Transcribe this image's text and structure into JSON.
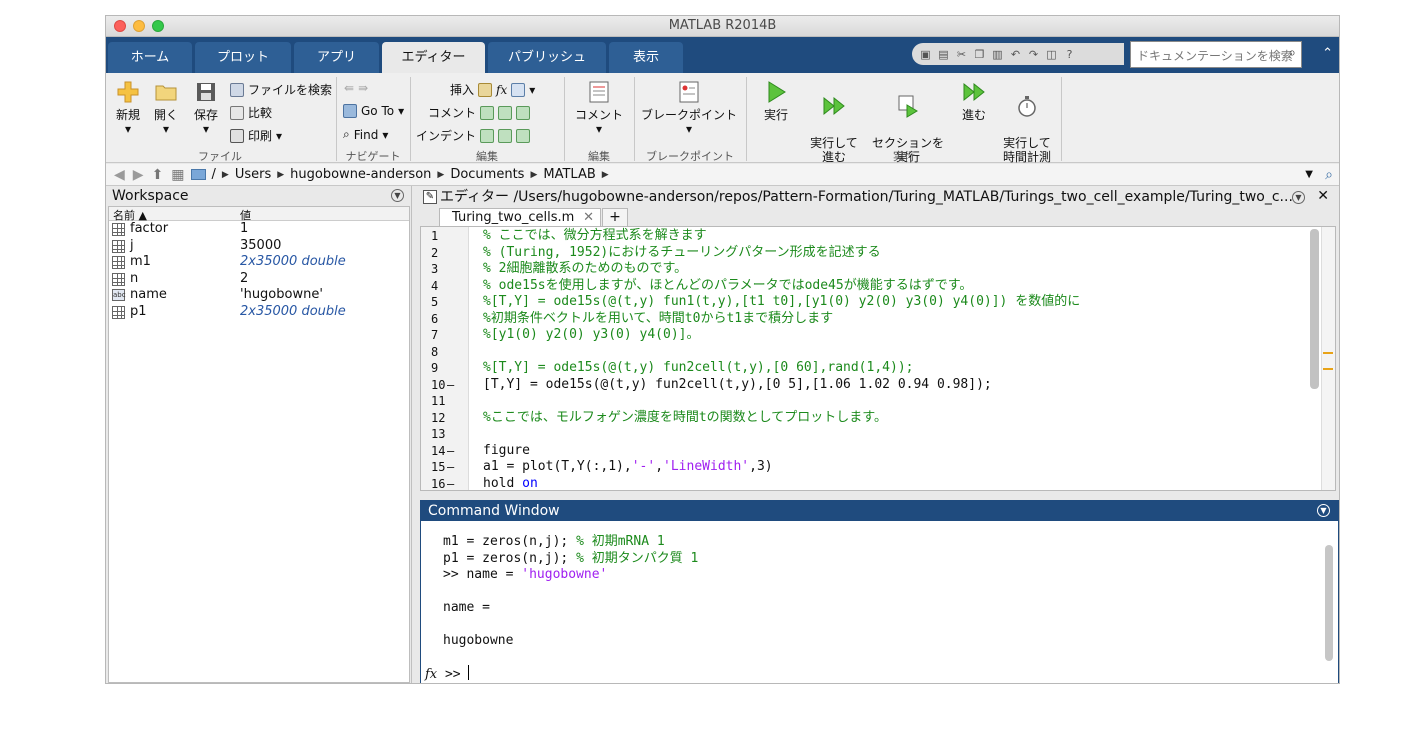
{
  "window": {
    "title": "MATLAB R2014B"
  },
  "tabs": [
    "ホーム",
    "プロット",
    "アプリ",
    "エディター",
    "パブリッシュ",
    "表示"
  ],
  "active_tab": "エディター",
  "doc_search": {
    "placeholder": "ドキュメンテーションを検索"
  },
  "toolstrip": {
    "file": {
      "label": "ファイル",
      "new": "新規",
      "open": "開く",
      "save": "保存",
      "find_files": "ファイルを検索",
      "compare": "比較",
      "print": "印刷"
    },
    "navigate": {
      "label": "ナビゲート",
      "goto": "Go To",
      "find": "Find"
    },
    "edit": {
      "label": "編集",
      "insert": "挿入",
      "fx": "fx",
      "comment": "コメント",
      "indent": "インデント"
    },
    "edit2": {
      "label": "編集",
      "comment": "コメント"
    },
    "breakpoints": {
      "label": "ブレークポイント",
      "button": "ブレークポイント"
    },
    "run": {
      "label": "実行",
      "run": "実行",
      "run_advance": "実行して\n進む",
      "run_section": "セクションを\n実行",
      "advance": "進む",
      "run_time": "実行して\n時間計測"
    }
  },
  "address": {
    "root": "/",
    "crumbs": [
      "Users",
      "hugobowne-anderson",
      "Documents",
      "MATLAB"
    ]
  },
  "workspace": {
    "title": "Workspace",
    "col_name": "名前 ▲",
    "col_value": "値",
    "rows": [
      {
        "name": "factor",
        "value": "1",
        "type": "grid",
        "italic": false
      },
      {
        "name": "j",
        "value": "35000",
        "type": "grid",
        "italic": false
      },
      {
        "name": "m1",
        "value": "2x35000 double",
        "type": "grid",
        "italic": true
      },
      {
        "name": "n",
        "value": "2",
        "type": "grid",
        "italic": false
      },
      {
        "name": "name",
        "value": "'hugobowne'",
        "type": "char",
        "italic": false
      },
      {
        "name": "p1",
        "value": "2x35000 double",
        "type": "grid",
        "italic": true
      }
    ]
  },
  "editor": {
    "title": "エディター /Users/hugobowne-anderson/repos/Pattern-Formation/Turing_MATLAB/Turings_two_cell_example/Turing_two_c...",
    "file_tab": "Turing_two_cells.m",
    "lines": [
      {
        "n": "1",
        "dash": false,
        "segs": [
          [
            "cm",
            "% ここでは、微分方程式系を解きます"
          ]
        ]
      },
      {
        "n": "2",
        "dash": false,
        "segs": [
          [
            "cm",
            "% (Turing, 1952)におけるチューリングパターン形成を記述する"
          ]
        ]
      },
      {
        "n": "3",
        "dash": false,
        "segs": [
          [
            "cm",
            "% 2細胞離散系のためのものです。"
          ]
        ]
      },
      {
        "n": "4",
        "dash": false,
        "segs": [
          [
            "cm",
            "% ode15sを使用しますが、ほとんどのパラメータではode45が機能するはずです。"
          ]
        ]
      },
      {
        "n": "5",
        "dash": false,
        "segs": [
          [
            "cm",
            "%[T,Y] = ode15s(@(t,y) fun1(t,y),[t1 t0],[y1(0) y2(0) y3(0) y4(0)]) を数値的に"
          ]
        ]
      },
      {
        "n": "6",
        "dash": false,
        "segs": [
          [
            "cm",
            "%初期条件ベクトルを用いて、時間t0からt1まで積分します"
          ]
        ]
      },
      {
        "n": "7",
        "dash": false,
        "segs": [
          [
            "cm",
            "%[y1(0) y2(0) y3(0) y4(0)]。"
          ]
        ]
      },
      {
        "n": "8",
        "dash": false,
        "segs": []
      },
      {
        "n": "9",
        "dash": false,
        "segs": [
          [
            "cm",
            "%[T,Y] = ode15s(@(t,y) fun2cell(t,y),[0 60],rand(1,4));"
          ]
        ]
      },
      {
        "n": "10",
        "dash": true,
        "segs": [
          [
            "tx",
            "[T,Y] = ode15s(@(t,y) fun2cell(t,y),[0 5],[1.06 1.02 0.94 0.98]);"
          ]
        ]
      },
      {
        "n": "11",
        "dash": false,
        "segs": []
      },
      {
        "n": "12",
        "dash": false,
        "segs": [
          [
            "cm",
            "%ここでは、モルフォゲン濃度を時間tの関数としてプロットします。"
          ]
        ]
      },
      {
        "n": "13",
        "dash": false,
        "segs": []
      },
      {
        "n": "14",
        "dash": true,
        "segs": [
          [
            "tx",
            "figure"
          ]
        ]
      },
      {
        "n": "15",
        "dash": true,
        "segs": [
          [
            "tx",
            "a1 = plot(T,Y(:,1),"
          ],
          [
            "st",
            "'-'"
          ],
          [
            "tx",
            ","
          ],
          [
            "st",
            "'LineWidth'"
          ],
          [
            "tx",
            ",3)"
          ]
        ]
      },
      {
        "n": "16",
        "dash": true,
        "segs": [
          [
            "tx",
            "hold "
          ],
          [
            "kw",
            "on"
          ]
        ]
      }
    ]
  },
  "command_window": {
    "title": "Command Window",
    "lines": [
      {
        "segs": [
          [
            "tx",
            "m1 = zeros(n,j); "
          ],
          [
            "cm",
            "% 初期mRNA 1"
          ]
        ]
      },
      {
        "segs": [
          [
            "tx",
            "p1 = zeros(n,j); "
          ],
          [
            "cm",
            "% 初期タンパク質 1"
          ]
        ]
      },
      {
        "segs": [
          [
            "tx",
            ">> name = "
          ],
          [
            "st",
            "'hugobowne'"
          ]
        ]
      },
      {
        "segs": []
      },
      {
        "segs": [
          [
            "tx",
            "name ="
          ]
        ]
      },
      {
        "segs": []
      },
      {
        "segs": [
          [
            "tx",
            "hugobowne"
          ]
        ]
      }
    ],
    "prompt": ">>"
  },
  "colors": {
    "ribbon": "#1f4b7e",
    "comment": "#1c8a1c",
    "string": "#a020f0",
    "keyword": "#0000ff"
  }
}
